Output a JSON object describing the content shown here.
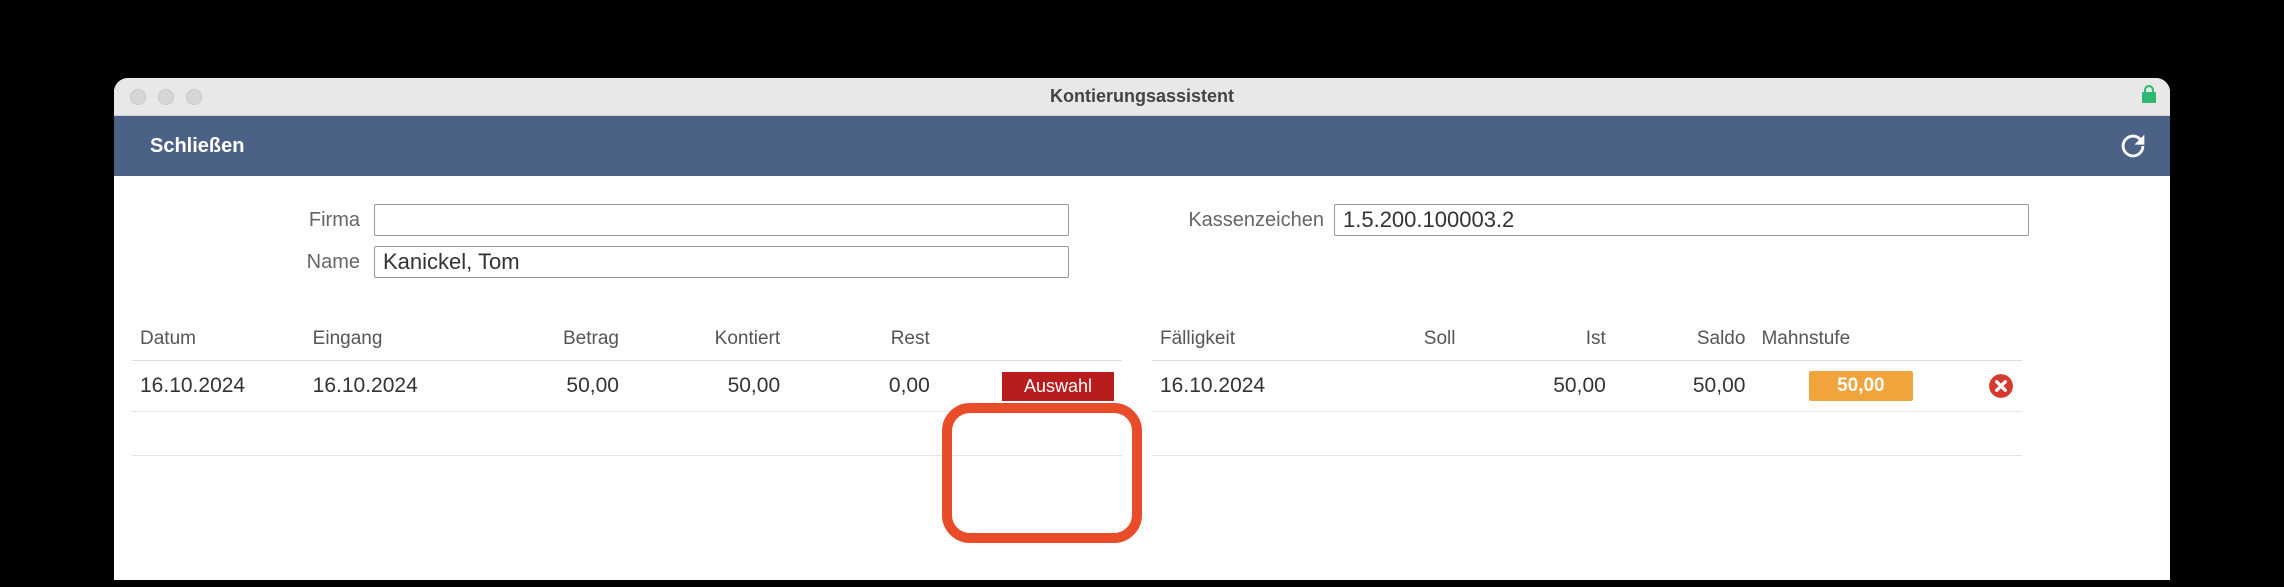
{
  "window": {
    "title": "Kontierungsassistent"
  },
  "toolbar": {
    "close_label": "Schließen"
  },
  "form": {
    "firma_label": "Firma",
    "firma_value": "",
    "name_label": "Name",
    "name_value": "Kanickel, Tom",
    "kassenzeichen_label": "Kassenzeichen",
    "kassenzeichen_value": "1.5.200.100003.2"
  },
  "left_table": {
    "headers": {
      "datum": "Datum",
      "eingang": "Eingang",
      "betrag": "Betrag",
      "kontiert": "Kontiert",
      "rest": "Rest",
      "aktion": ""
    },
    "row": {
      "datum": "16.10.2024",
      "eingang": "16.10.2024",
      "betrag": "50,00",
      "kontiert": "50,00",
      "rest": "0,00",
      "auswahl_label": "Auswahl"
    }
  },
  "right_table": {
    "headers": {
      "faelligkeit": "Fälligkeit",
      "soll": "Soll",
      "ist": "Ist",
      "saldo": "Saldo",
      "mahnstufe": "Mahnstufe",
      "aktion": ""
    },
    "row": {
      "faelligkeit": "16.10.2024",
      "soll": "",
      "ist": "50,00",
      "saldo": "50,00",
      "badge": "50,00"
    }
  }
}
